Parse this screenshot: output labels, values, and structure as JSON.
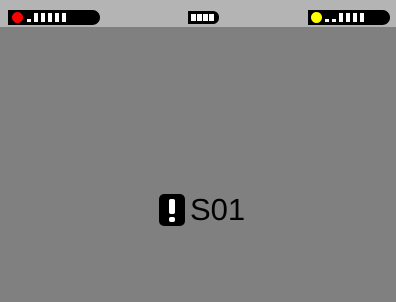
{
  "status_bar": {
    "left_indicator": {
      "led_color": "#ff0000",
      "signal_bars_filled": 5,
      "signal_bars_total": 6
    },
    "battery": {
      "icon": "battery-icon",
      "cells_filled": 4,
      "cells_total": 4
    },
    "right_indicator": {
      "led_color": "#ffff00",
      "signal_bars_filled": 4,
      "signal_bars_total": 6
    }
  },
  "alert": {
    "icon": "exclamation-icon",
    "code": "S01"
  },
  "colors": {
    "screen_background": "#808080",
    "status_bar_background": "#b4b4b4"
  }
}
